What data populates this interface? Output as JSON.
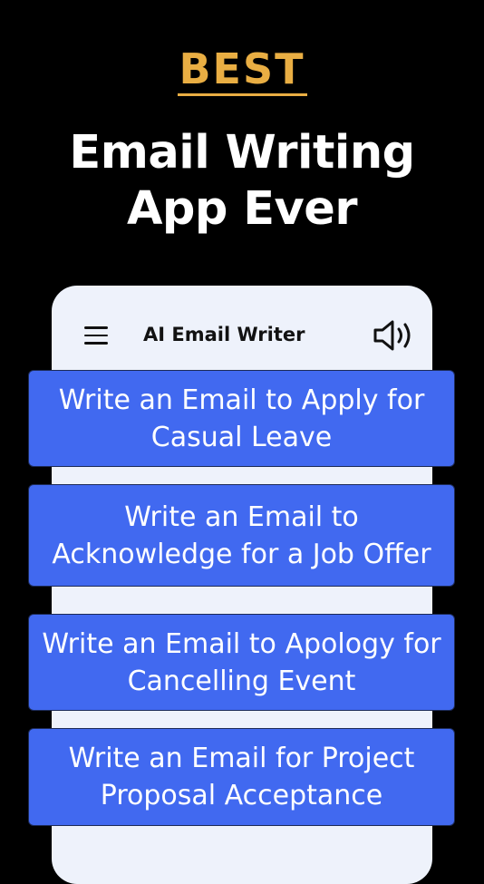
{
  "promo": {
    "badge": "BEST",
    "headline_line1": "Email Writing",
    "headline_line2": "App Ever"
  },
  "appbar": {
    "menu_icon": "hamburger-menu-icon",
    "title": "AI Email Writer",
    "speaker_icon": "speaker-volume-icon"
  },
  "prompts": [
    {
      "label": "Write an Email to Apply for Casual Leave"
    },
    {
      "label": "Write an Email to Acknowledge for a Job Offer"
    },
    {
      "label": "Write an Email to Apology for Cancelling Event"
    },
    {
      "label": "Write an Email for Project Proposal Acceptance"
    }
  ],
  "colors": {
    "background": "#000000",
    "badge": "#e9ae43",
    "headline": "#ffffff",
    "screen": "#eef2fb",
    "card": "#4169f0",
    "card_border": "#1c2a57"
  }
}
